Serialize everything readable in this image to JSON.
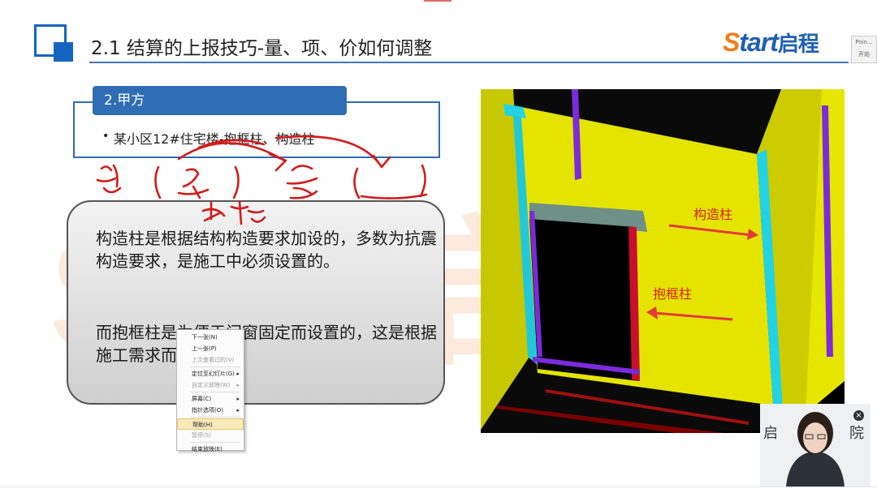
{
  "slide": {
    "title": "2.1 结算的上报技巧-量、项、价如何调整",
    "watermark": "Start启程",
    "logo": {
      "latin_s": "S",
      "latin_rest": "tart",
      "cn": "启程"
    }
  },
  "side_strip": {
    "line1": "Poin...",
    "line2": "开始"
  },
  "party_box": {
    "header": "2.甲方",
    "bullet": "某小区12#住宅楼-抱框柱、构造柱"
  },
  "note": {
    "p1": "构造柱是根据结构构造要求加设的，多数为抗震构造要求，是施工中必须设置的。",
    "p2": "而抱框柱是为便于门窗固定而设置的，这是根据施工需求而定的。"
  },
  "context_menu": {
    "items": [
      {
        "label": "下一张(N)",
        "enabled": true,
        "submenu": false
      },
      {
        "label": "上一张(P)",
        "enabled": true,
        "submenu": false
      },
      {
        "label": "上次查看过的(V)",
        "enabled": false,
        "submenu": false
      },
      {
        "label": "定位至幻灯片(G)",
        "enabled": true,
        "submenu": true
      },
      {
        "label": "自定义放映(W)",
        "enabled": false,
        "submenu": true
      },
      {
        "label": "屏幕(C)",
        "enabled": true,
        "submenu": true
      },
      {
        "label": "指针选项(O)",
        "enabled": true,
        "submenu": true
      },
      {
        "label": "帮助(H)",
        "enabled": true,
        "submenu": false,
        "highlighted": true
      },
      {
        "label": "暂停(S)",
        "enabled": false,
        "submenu": false
      },
      {
        "label": "结束放映(E)",
        "enabled": true,
        "submenu": false
      }
    ]
  },
  "render": {
    "label_gouzaozhu": "构造柱",
    "label_baokuangzhu": "抱框柱"
  },
  "video": {
    "banner": "启",
    "banner2": "院",
    "close": "×"
  },
  "colors": {
    "accent_blue": "#2f6db4",
    "logo_orange": "#f07c1e",
    "wall_yellow": "#e8e800",
    "column_cyan": "#22d3e6",
    "column_purple": "#7b2bd9",
    "column_red": "#c8102e"
  }
}
